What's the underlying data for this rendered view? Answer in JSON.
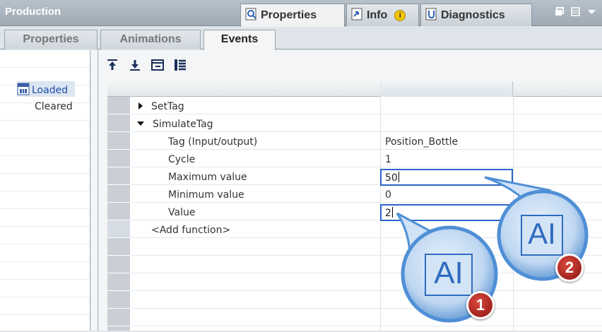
{
  "titlebar": {
    "title": "Production",
    "tabs": [
      {
        "label": "Properties",
        "icon": "magnifier-properties-icon"
      },
      {
        "label": "Info",
        "icon": "info-arrow-icon",
        "badge": "i"
      },
      {
        "label": "Diagnostics",
        "icon": "diagnostics-icon"
      }
    ],
    "window_controls": [
      "restore-icon",
      "list-icon",
      "dropdown-icon"
    ]
  },
  "subtabs": [
    {
      "label": "Properties"
    },
    {
      "label": "Animations"
    },
    {
      "label": "Events"
    }
  ],
  "events": [
    {
      "label": "Loaded",
      "icon": "event-icon"
    },
    {
      "label": "Cleared"
    }
  ],
  "toolbar": [
    "move-up-icon",
    "move-down-icon",
    "collapse-icon",
    "expand-all-icon"
  ],
  "functions": {
    "settag_label": "SetTag",
    "simulatetag_label": "SimulateTag",
    "params": [
      {
        "label": "Tag (Input/output)",
        "value": "Position_Bottle"
      },
      {
        "label": "Cycle",
        "value": "1"
      },
      {
        "label": "Maximum value",
        "value": "50"
      },
      {
        "label": "Minimum value",
        "value": "0"
      },
      {
        "label": "Value",
        "value": "2"
      }
    ],
    "add_function": "<Add function>"
  },
  "callouts": [
    {
      "number": "1",
      "glyph": "AI"
    },
    {
      "number": "2",
      "glyph": "AI"
    }
  ],
  "colors": {
    "accent": "#2a63c9",
    "callout_blue": "#4f8fd6",
    "badge_red": "#b01e1e"
  }
}
